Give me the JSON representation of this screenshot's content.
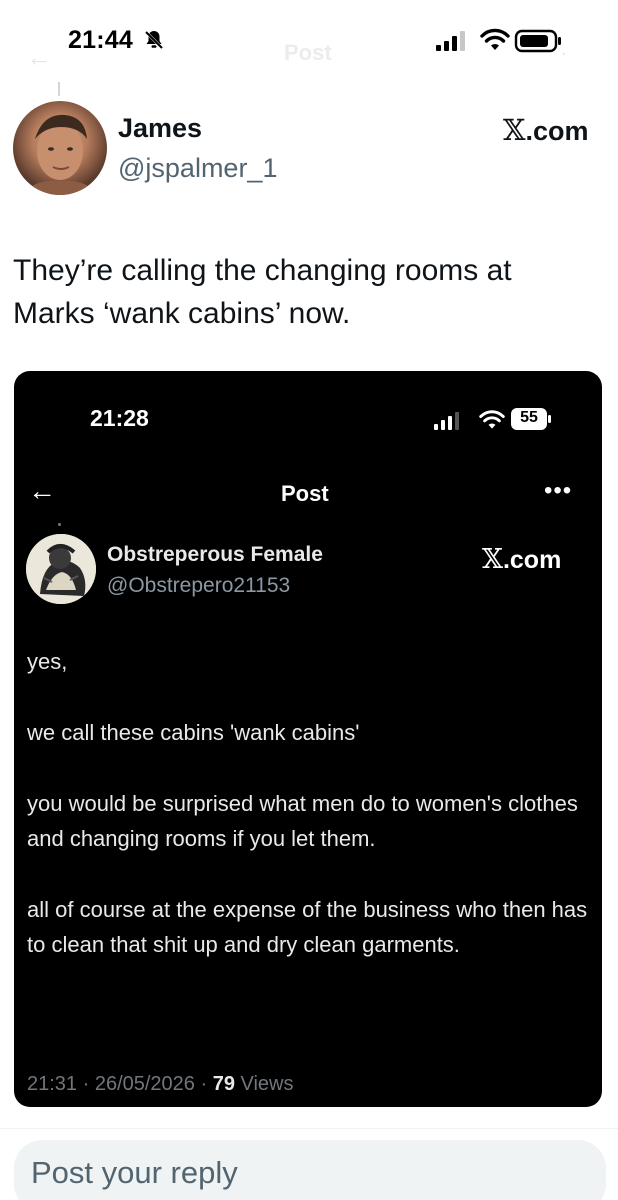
{
  "status_bar": {
    "time": "21:44",
    "ghost_title": "Post"
  },
  "tweet": {
    "author_name": "James",
    "author_handle": "@jspalmer_1",
    "brand_x": "𝕏",
    "brand_suffix": ".com",
    "text_line1": "They’re calling the changing rooms at",
    "text_line2": "Marks ‘wank cabins’ now."
  },
  "embedded": {
    "status_time": "21:28",
    "battery_level": "55",
    "nav_title": "Post",
    "more_label": "•••",
    "back_label": "←",
    "author_name": "Obstreperous Female",
    "author_handle": "@Obstrepero21153",
    "brand_x": "𝕏",
    "brand_suffix": ".com",
    "paragraphs": [
      "yes,",
      "we call these cabins 'wank cabins'",
      "you would be surprised what men do to women's clothes and changing rooms if you let them.",
      "all of course at the expense of the business who then has to clean that shit up and dry clean garments."
    ],
    "meta_timestamp": "21:31 · 26/05/2026 · ",
    "meta_views_count": "79",
    "meta_views_label": " Views"
  },
  "reply": {
    "placeholder": "Post your reply"
  },
  "colors": {
    "text_primary": "#0f1419",
    "text_secondary": "#536471",
    "card_background": "#000000",
    "reply_background": "#eff3f4"
  }
}
